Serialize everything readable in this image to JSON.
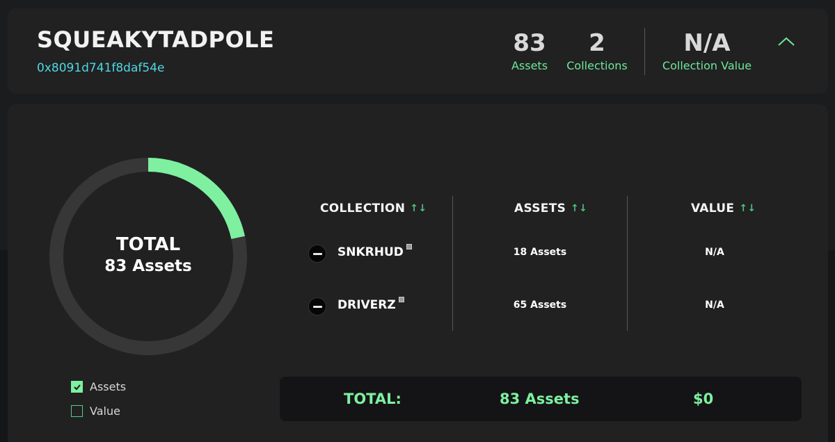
{
  "header": {
    "username": "SQUEAKYTADPOLE",
    "address": "0x8091d741f8daf54e",
    "stats": {
      "assets": {
        "value": "83",
        "label": "Assets"
      },
      "collections": {
        "value": "2",
        "label": "Collections"
      },
      "collection_value": {
        "value": "N/A",
        "label": "Collection Value"
      }
    },
    "collapse_icon": "chevron-up-icon"
  },
  "donut": {
    "line1": "TOTAL",
    "line2": "83 Assets",
    "segments": [
      {
        "name": "SNKRHUD",
        "value": 18,
        "color": "#7ef0a0"
      },
      {
        "name": "DRIVERZ",
        "value": 65,
        "color": "#3a3a3b"
      }
    ]
  },
  "legend": {
    "assets": {
      "label": "Assets",
      "checked": true
    },
    "value": {
      "label": "Value",
      "checked": false
    }
  },
  "table": {
    "headers": {
      "collection": "COLLECTION",
      "assets": "ASSETS",
      "value": "VALUE"
    },
    "sort_icon": "↑↓",
    "rows": [
      {
        "name": "SNKRHUD",
        "assets": "18 Assets",
        "value": "N/A"
      },
      {
        "name": "DRIVERZ",
        "assets": "65 Assets",
        "value": "N/A"
      }
    ],
    "total": {
      "label": "TOTAL:",
      "assets": "83 Assets",
      "value": "$0"
    }
  },
  "colors": {
    "accent": "#7ef0a0",
    "address": "#4fd8e2",
    "card": "#212122",
    "background": "#151618"
  }
}
